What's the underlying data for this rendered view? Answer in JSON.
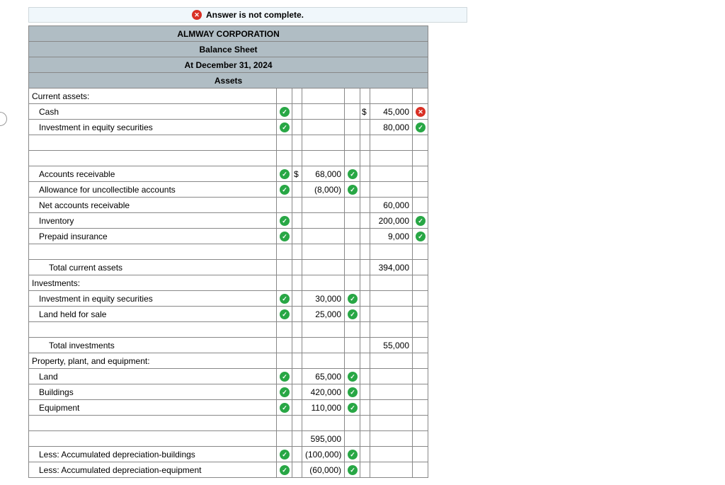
{
  "status": {
    "text": "Answer is not complete."
  },
  "headers": {
    "company": "ALMWAY CORPORATION",
    "title": "Balance Sheet",
    "date": "At December 31, 2024",
    "section": "Assets"
  },
  "lines": {
    "current_assets": "Current assets:",
    "cash": "Cash",
    "cash_val": "45,000",
    "inv_eq_sec": "Investment in equity securities",
    "inv_eq_sec_val": "80,000",
    "ar": "Accounts receivable",
    "ar_val": "68,000",
    "allowance": "Allowance for uncollectible accounts",
    "allowance_val": "(8,000)",
    "net_ar": "Net accounts receivable",
    "net_ar_val": "60,000",
    "inventory": "Inventory",
    "inventory_val": "200,000",
    "prepaid": "Prepaid insurance",
    "prepaid_val": "9,000",
    "total_current": "Total current assets",
    "total_current_val": "394,000",
    "investments": "Investments:",
    "inv_eq_sec2": "Investment in equity securities",
    "inv_eq_sec2_val": "30,000",
    "land_held": "Land held for sale",
    "land_held_val": "25,000",
    "total_inv": "Total investments",
    "total_inv_val": "55,000",
    "ppe": "Property, plant, and equipment:",
    "land": "Land",
    "land_val": "65,000",
    "buildings": "Buildings",
    "buildings_val": "420,000",
    "equipment": "Equipment",
    "equipment_val": "110,000",
    "ppe_subtotal": "595,000",
    "dep_buildings": "Less: Accumulated depreciation-buildings",
    "dep_buildings_val": "(100,000)",
    "dep_equipment": "Less: Accumulated depreciation-equipment",
    "dep_equipment_val": "(60,000)"
  },
  "dollar": "$"
}
